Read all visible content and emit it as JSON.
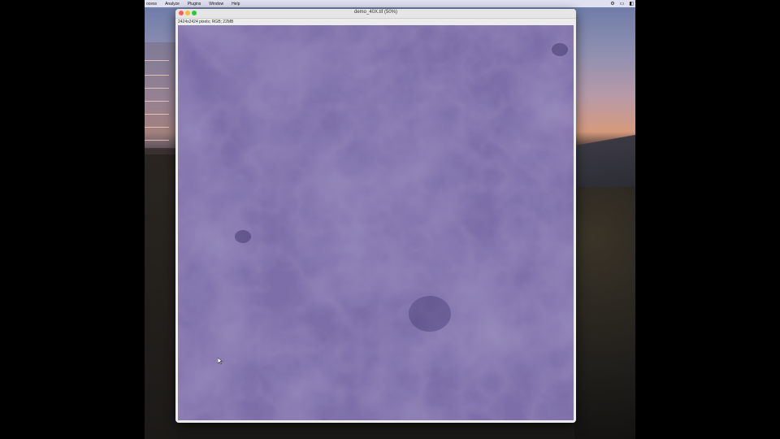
{
  "menubar": {
    "items": [
      "ocess",
      "Analyze",
      "Plugins",
      "Window",
      "Help"
    ],
    "status_icons": [
      "gear-icon",
      "airplay-icon",
      "menu-extra-icon"
    ]
  },
  "window": {
    "title": "demo_40X.tif (50%)",
    "info": "2424x2424 pixels; RGB; 22MB"
  },
  "colors": {
    "tissue_base": "#7a6aa6",
    "tissue_light": "#9486c0",
    "tissue_dark": "#4e3f7a"
  }
}
